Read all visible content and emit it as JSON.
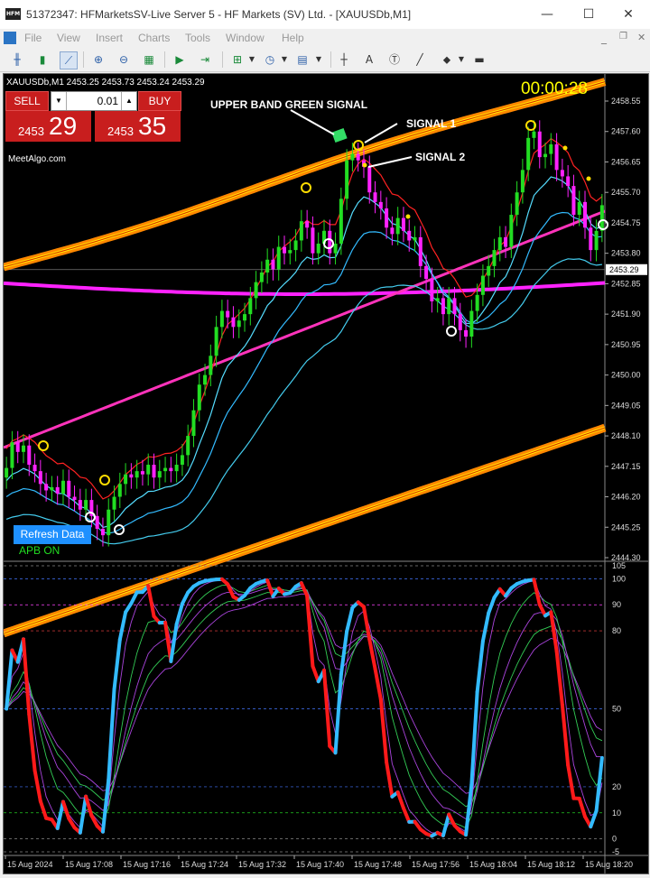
{
  "window": {
    "title": "51372347: HFMarketsSV-Live Server 5 - HF Markets (SV) Ltd. - [XAUUSDb,M1]",
    "logo": "HFM",
    "controls": [
      "minimize-icon",
      "maximize-icon",
      "close-icon"
    ]
  },
  "menu": [
    "File",
    "View",
    "Insert",
    "Charts",
    "Tools",
    "Window",
    "Help"
  ],
  "chart": {
    "symbol_info": "XAUUSDb,M1  2453.25 2453.73 2453.24 2453.29",
    "timer": "00:00:28",
    "watermark": "MeetAlgo.com",
    "current_price_label": "2453.29",
    "trade_panel": {
      "sell_label": "SELL",
      "buy_label": "BUY",
      "lot": "0.01",
      "sell_prefix": "2453",
      "sell_big": "29",
      "buy_prefix": "2453",
      "buy_big": "35"
    },
    "annotations": {
      "upper_band": "UPPER BAND GREEN SIGNAL",
      "signal1": "SIGNAL 1",
      "signal2": "SIGNAL 2"
    },
    "refresh_label": "Refresh Data",
    "apb_label": "APB ON",
    "price_axis": [
      "2458.55",
      "2457.60",
      "2456.65",
      "2455.70",
      "2454.75",
      "2453.80",
      "2452.85",
      "2451.90",
      "2450.95",
      "2450.00",
      "2449.05",
      "2448.10",
      "2447.15",
      "2446.20",
      "2445.25",
      "2444.30"
    ],
    "osc_axis": [
      "105",
      "100",
      "90",
      "80",
      "50",
      "20",
      "10",
      "0",
      "-5"
    ],
    "time_axis": [
      "15 Aug 2024",
      "15 Aug 17:08",
      "15 Aug 17:16",
      "15 Aug 17:24",
      "15 Aug 17:32",
      "15 Aug 17:40",
      "15 Aug 17:48",
      "15 Aug 17:56",
      "15 Aug 18:04",
      "15 Aug 18:12",
      "15 Aug 18:20"
    ],
    "colors": {
      "bull": "#22dd22",
      "bear": "#ff22ff",
      "band": "#ff9900",
      "ma": "#ff33bb",
      "signal": "#ff2222",
      "cyan": "#33ccff"
    }
  },
  "chart_data": {
    "type": "candlestick",
    "title": "XAUUSDb,M1",
    "ylim": [
      2444.3,
      2458.55
    ],
    "oscillator_ylim": [
      -5,
      105
    ],
    "close": [
      2447.1,
      2447.9,
      2447.6,
      2447.8,
      2447.2,
      2447.0,
      2446.6,
      2446.4,
      2446.5,
      2446.3,
      2446.7,
      2446.2,
      2446.1,
      2445.8,
      2446.1,
      2445.6,
      2445.2,
      2445.0,
      2445.8,
      2446.2,
      2446.6,
      2446.9,
      2446.8,
      2447.0,
      2446.9,
      2447.2,
      2446.8,
      2447.0,
      2447.1,
      2447.0,
      2447.2,
      2447.5,
      2448.1,
      2448.9,
      2449.7,
      2450.0,
      2450.6,
      2451.5,
      2452.0,
      2451.8,
      2451.5,
      2451.7,
      2451.9,
      2452.4,
      2452.9,
      2453.2,
      2453.6,
      2453.3,
      2454.0,
      2453.8,
      2453.9,
      2454.2,
      2454.8,
      2454.6,
      2453.8,
      2454.1,
      2454.5,
      2453.8,
      2454.1,
      2455.5,
      2456.7,
      2456.9,
      2456.7,
      2456.5,
      2455.7,
      2455.4,
      2455.2,
      2454.6,
      2454.4,
      2454.9,
      2454.5,
      2454.2,
      2454.3,
      2453.4,
      2453.0,
      2452.3,
      2452.4,
      2451.9,
      2452.4,
      2451.9,
      2451.4,
      2451.2,
      2452.0,
      2452.5,
      2453.1,
      2453.4,
      2453.9,
      2454.3,
      2454.0,
      2455.0,
      2455.7,
      2456.4,
      2457.4,
      2457.6,
      2456.8,
      2456.9,
      2457.2,
      2456.4,
      2456.2,
      2455.9,
      2455.0,
      2455.4,
      2454.6,
      2453.9,
      2454.5,
      2455.3
    ]
  }
}
